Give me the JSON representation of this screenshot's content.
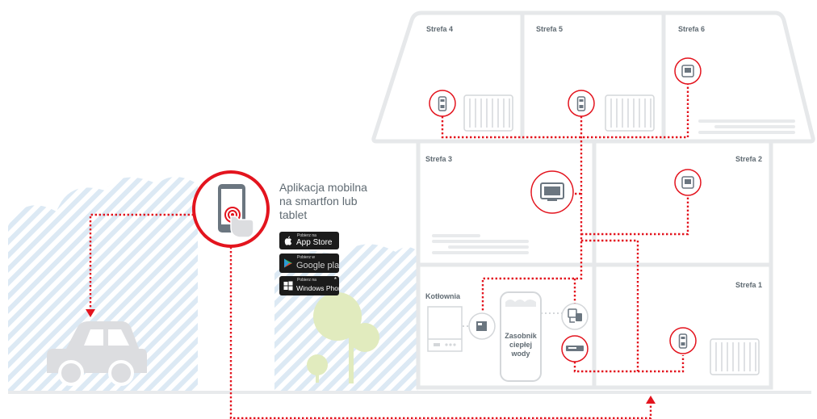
{
  "zones": {
    "z1": "Strefa 1",
    "z2": "Strefa 2",
    "z3": "Strefa 3",
    "z4": "Strefa 4",
    "z5": "Strefa 5",
    "z6": "Strefa 6"
  },
  "boiler_room": "Kotłownia",
  "tank": {
    "line1": "Zasobnik",
    "line2": "ciepłej",
    "line3": "wody"
  },
  "app": {
    "line1": "Aplikacja mobilna",
    "line2": "na smartfon lub",
    "line3": "tablet"
  },
  "stores": {
    "appstore": {
      "small": "Pobierz na",
      "big": "App Store"
    },
    "googleplay": {
      "small": "Pobierz w",
      "big": "Google play"
    },
    "windows": {
      "small": "Pobierz na",
      "big": "Windows Phone"
    }
  },
  "colors": {
    "accent": "#e3141e",
    "house_stroke": "#e6e8ea",
    "bg_hatch": "#d9e8f3",
    "tree": "#e1ebbe",
    "car": "#dcdde0"
  },
  "icons": [
    "smartphone-touch-icon",
    "thermostat-icon",
    "room-controller-icon",
    "tv-monitor-icon",
    "radiator-icon",
    "boiler-icon",
    "hot-water-tank-icon",
    "valve-icon",
    "car-icon",
    "tree-icon"
  ]
}
